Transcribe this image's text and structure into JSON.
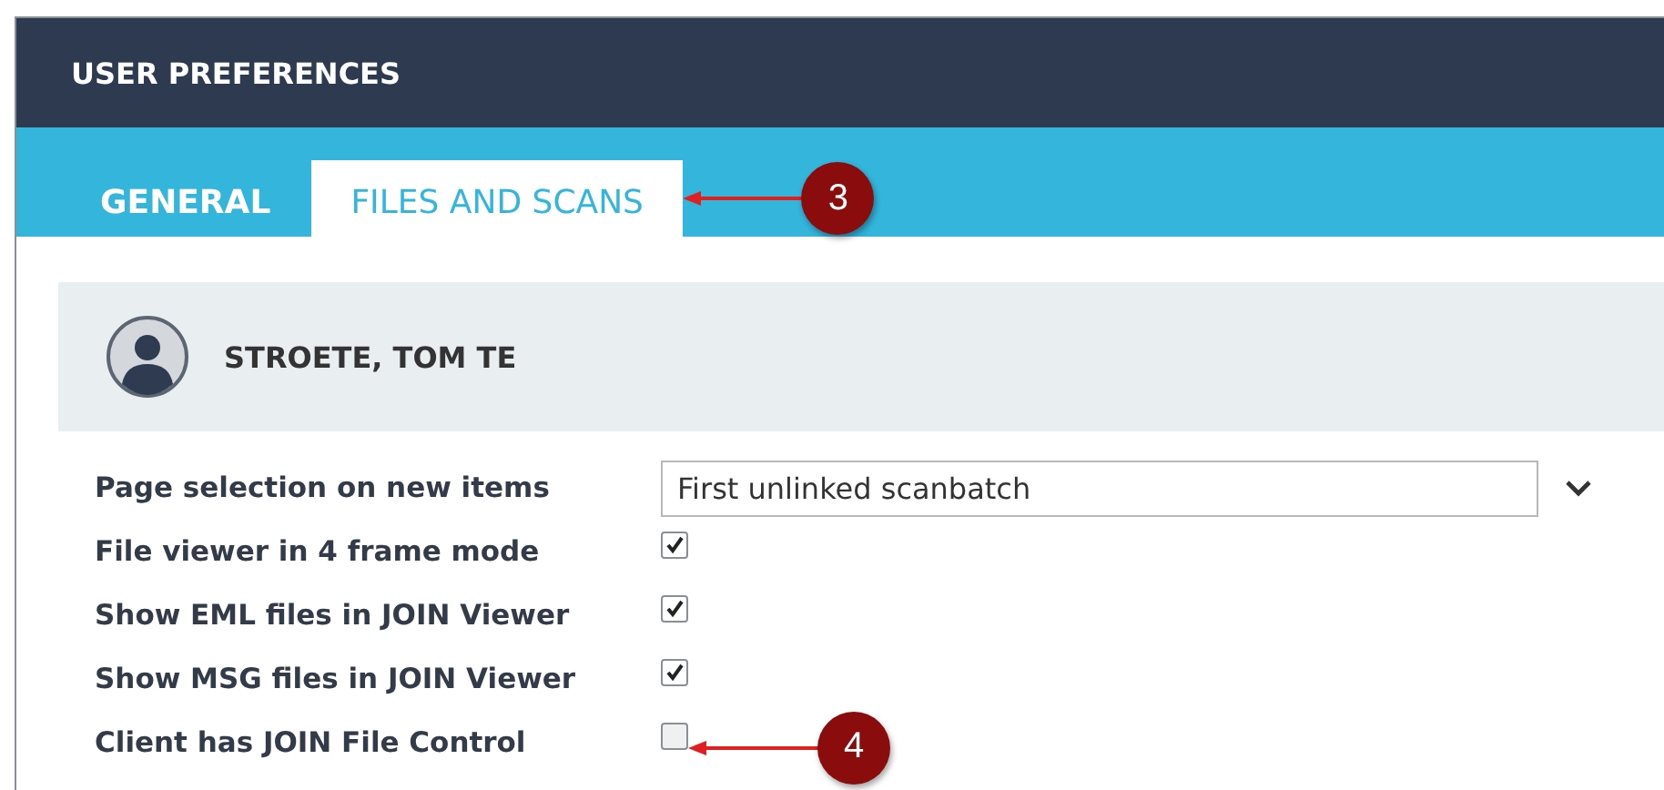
{
  "header": {
    "title": "USER PREFERENCES"
  },
  "tabs": [
    {
      "label": "GENERAL",
      "selected": false
    },
    {
      "label": "FILES AND SCANS",
      "selected": true,
      "callout": "3"
    }
  ],
  "user": {
    "name": "STROETE, TOM TE"
  },
  "settings": [
    {
      "kind": "dropdown",
      "label": "Page selection on new items",
      "value": "First unlinked scanbatch"
    },
    {
      "kind": "checkbox",
      "label": "File viewer in 4 frame mode",
      "checked": true
    },
    {
      "kind": "checkbox",
      "label": "Show EML files in JOIN Viewer",
      "checked": true
    },
    {
      "kind": "checkbox",
      "label": "Show MSG files in JOIN Viewer",
      "checked": true
    },
    {
      "kind": "checkbox",
      "label": "Client has JOIN File Control",
      "checked": false,
      "callout": "4"
    }
  ]
}
